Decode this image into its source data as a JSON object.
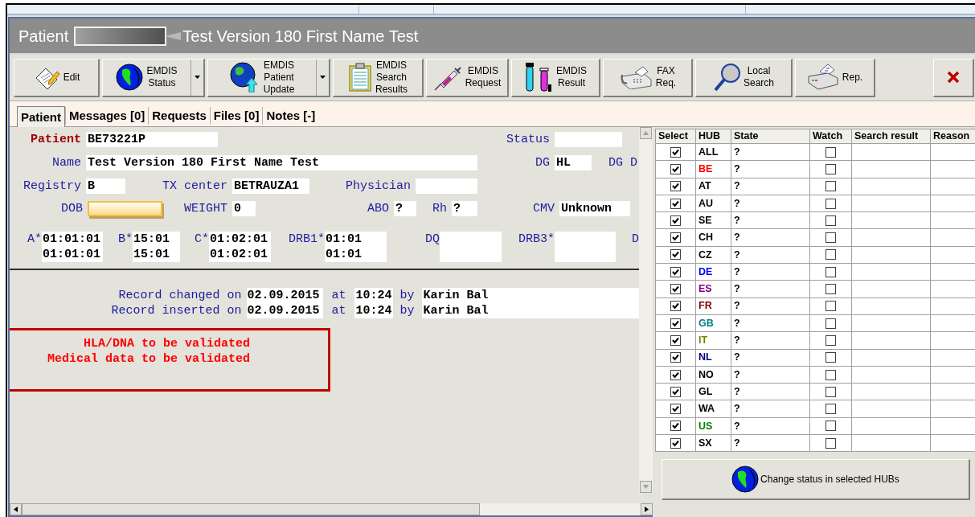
{
  "window": {
    "title_label": "Patient",
    "title_name": "Test Version 180 First Name Test"
  },
  "toolbar": [
    {
      "lines": [
        "Edit"
      ],
      "dropdown": false
    },
    {
      "lines": [
        "EMDIS",
        "Status"
      ],
      "dropdown": true
    },
    {
      "lines": [
        "EMDIS",
        "Patient",
        "Update"
      ],
      "dropdown": true
    },
    {
      "lines": [
        "EMDIS",
        "Search",
        "Results"
      ],
      "dropdown": false
    },
    {
      "lines": [
        "EMDIS",
        "Request"
      ],
      "dropdown": false
    },
    {
      "lines": [
        "EMDIS",
        "Result"
      ],
      "dropdown": false
    },
    {
      "lines": [
        "FAX",
        "Req."
      ],
      "dropdown": false
    },
    {
      "lines": [
        "Local",
        "Search"
      ],
      "dropdown": false
    },
    {
      "lines": [
        "Rep."
      ],
      "dropdown": false
    }
  ],
  "tabs": [
    {
      "label": "Patient",
      "selected": true
    },
    {
      "label": "Messages [0]",
      "selected": false
    },
    {
      "label": "Requests",
      "selected": false
    },
    {
      "label": "Files [0]",
      "selected": false
    },
    {
      "label": "Notes [-]",
      "selected": false
    }
  ],
  "form": {
    "rows": [
      {
        "fields": [
          {
            "kind": "field",
            "label": "Patient",
            "value": "BE73221P",
            "emphasis": true
          },
          {
            "kind": "field",
            "label": "Status"
          }
        ]
      },
      {
        "fields": [
          {
            "kind": "field",
            "label": "Name",
            "value": "Test Version 180 First Name Test"
          },
          {
            "kind": "field",
            "label": "DG",
            "value": "HL"
          }
        ],
        "edge_label": "DG D"
      },
      {
        "fields": [
          {
            "kind": "field",
            "label": "Registry",
            "value": "B"
          },
          {
            "kind": "field",
            "label": "TX center",
            "value": "BETRAUZA1"
          },
          {
            "kind": "field",
            "label": "Physician"
          }
        ]
      },
      {
        "fields": [
          {
            "kind": "field",
            "label": "DOB",
            "focused": true
          },
          {
            "kind": "field",
            "label": "WEIGHT",
            "value": "0"
          },
          {
            "kind": "field",
            "label": "ABO",
            "value": "?"
          },
          {
            "kind": "field",
            "label": "Rh",
            "value": "?"
          },
          {
            "kind": "field",
            "label": "CMV",
            "value": "Unknown"
          }
        ]
      },
      {
        "fields": [
          {
            "kind": "hla",
            "label": "A*",
            "values": [
              "01:01:01",
              "01:01:01"
            ]
          },
          {
            "kind": "hla",
            "label": "B*",
            "values": [
              "15:01",
              "15:01"
            ]
          },
          {
            "kind": "hla",
            "label": "C*",
            "values": [
              "01:02:01",
              "01:02:01"
            ]
          },
          {
            "kind": "hla",
            "label": "DRB1*",
            "values": [
              "01:01",
              "01:01"
            ]
          },
          {
            "kind": "hla",
            "label": "DQ"
          },
          {
            "kind": "hla",
            "label": "DRB3*"
          }
        ],
        "edge_label": "D"
      }
    ],
    "record_lines": [
      {
        "label": "Record changed on",
        "date": "02.09.2015",
        "at": "at",
        "time": "10:24",
        "by": "by",
        "user": "Karin Bal"
      },
      {
        "label": "Record inserted on",
        "date": "02.09.2015",
        "at": "at",
        "time": "10:24",
        "by": "by",
        "user": "Karin Bal"
      }
    ],
    "warnings": [
      "HLA/DNA to be validated",
      "Medical data to be validated"
    ]
  },
  "hub_table": {
    "columns": [
      "Select",
      "HUB",
      "State",
      "Watch",
      "Search result",
      "Reason"
    ],
    "rows": [
      {
        "checked": true,
        "hub": "ALL",
        "color": "#000000",
        "state": "?",
        "watched": false
      },
      {
        "checked": true,
        "hub": "BE",
        "color": "#ff0000",
        "state": "?",
        "watched": false
      },
      {
        "checked": true,
        "hub": "AT",
        "color": "#000000",
        "state": "?",
        "watched": false
      },
      {
        "checked": true,
        "hub": "AU",
        "color": "#000000",
        "state": "?",
        "watched": false
      },
      {
        "checked": true,
        "hub": "SE",
        "color": "#000000",
        "state": "?",
        "watched": false
      },
      {
        "checked": true,
        "hub": "CH",
        "color": "#000000",
        "state": "?",
        "watched": false
      },
      {
        "checked": true,
        "hub": "CZ",
        "color": "#000000",
        "state": "?",
        "watched": false
      },
      {
        "checked": true,
        "hub": "DE",
        "color": "#0000ff",
        "state": "?",
        "watched": false
      },
      {
        "checked": true,
        "hub": "ES",
        "color": "#800080",
        "state": "?",
        "watched": false
      },
      {
        "checked": true,
        "hub": "FR",
        "color": "#800000",
        "state": "?",
        "watched": false
      },
      {
        "checked": true,
        "hub": "GB",
        "color": "#008080",
        "state": "?",
        "watched": false
      },
      {
        "checked": true,
        "hub": "IT",
        "color": "#808000",
        "state": "?",
        "watched": false
      },
      {
        "checked": true,
        "hub": "NL",
        "color": "#000080",
        "state": "?",
        "watched": false
      },
      {
        "checked": true,
        "hub": "NO",
        "color": "#000000",
        "state": "?",
        "watched": false
      },
      {
        "checked": true,
        "hub": "GL",
        "color": "#000000",
        "state": "?",
        "watched": false
      },
      {
        "checked": true,
        "hub": "WA",
        "color": "#000000",
        "state": "?",
        "watched": false
      },
      {
        "checked": true,
        "hub": "US",
        "color": "#008000",
        "state": "?",
        "watched": false
      },
      {
        "checked": true,
        "hub": "SX",
        "color": "#000000",
        "state": "?",
        "watched": false
      }
    ],
    "action_button": "Change status in selected HUBs"
  }
}
